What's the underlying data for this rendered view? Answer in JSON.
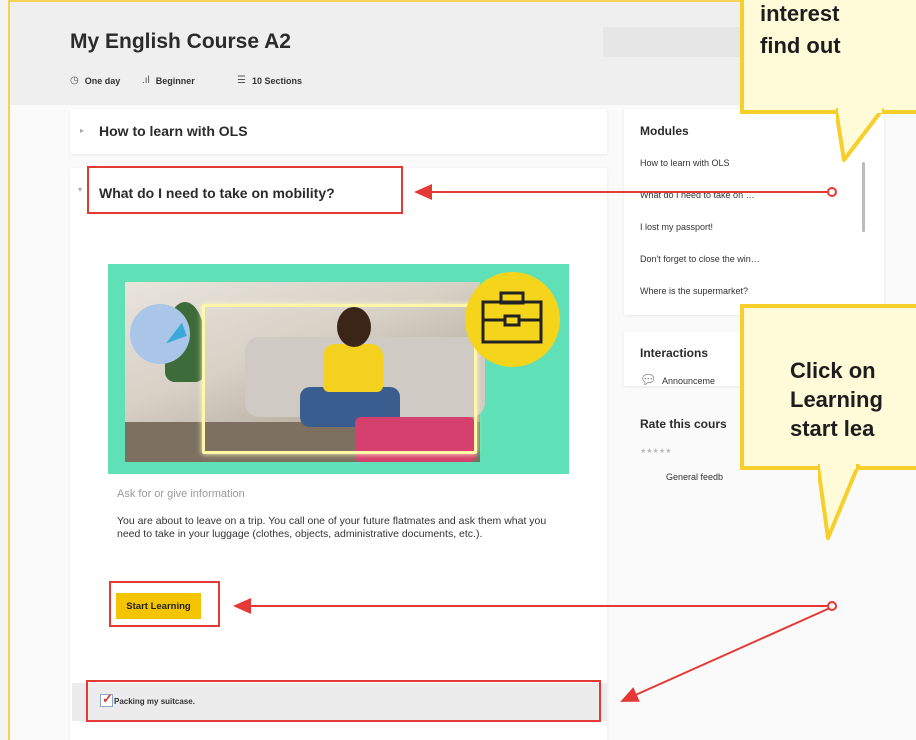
{
  "course": {
    "title": "My English Course A2",
    "meta": [
      {
        "icon": "clock-icon",
        "glyph": "◷",
        "label": "One day"
      },
      {
        "icon": "level-bars-icon",
        "glyph": ".ıl",
        "label": "Beginner"
      },
      {
        "icon": "list-icon",
        "glyph": "☰",
        "label": "10 Sections"
      }
    ]
  },
  "sections": [
    {
      "title": "How to learn with OLS"
    },
    {
      "title": "What do I need to take on mobility?"
    }
  ],
  "activity": {
    "label": "Ask for or give information",
    "description": "You are about to leave on a trip. You call one of your future flatmates and ask them what you need to take in your luggage (clothes, objects, administrative documents, etc.).",
    "start_button": "Start Learning",
    "subitem": "Packing my suitcase."
  },
  "sidebar": {
    "modules_title": "Modules",
    "modules": [
      "How to learn with OLS",
      "What do I need to take on …",
      "I lost my passport!",
      "Don't forget to close the win…",
      "Where is the supermarket?"
    ],
    "interactions_title": "Interactions",
    "interaction_item": "Announceme",
    "rate_title": "Rate this cours",
    "rating_stars": "★★★★★",
    "feedback_label": "General feedb"
  },
  "callouts": {
    "top_line1": "interest",
    "top_line2": "find out",
    "bottom_line1": "Click on",
    "bottom_line2": "Learning",
    "bottom_line3": "start lea"
  },
  "colors": {
    "accent_yellow": "#f5c400",
    "callout_border": "#f6cf2b",
    "annotation_red": "#e53935",
    "hero_green": "#5fe0b6"
  }
}
